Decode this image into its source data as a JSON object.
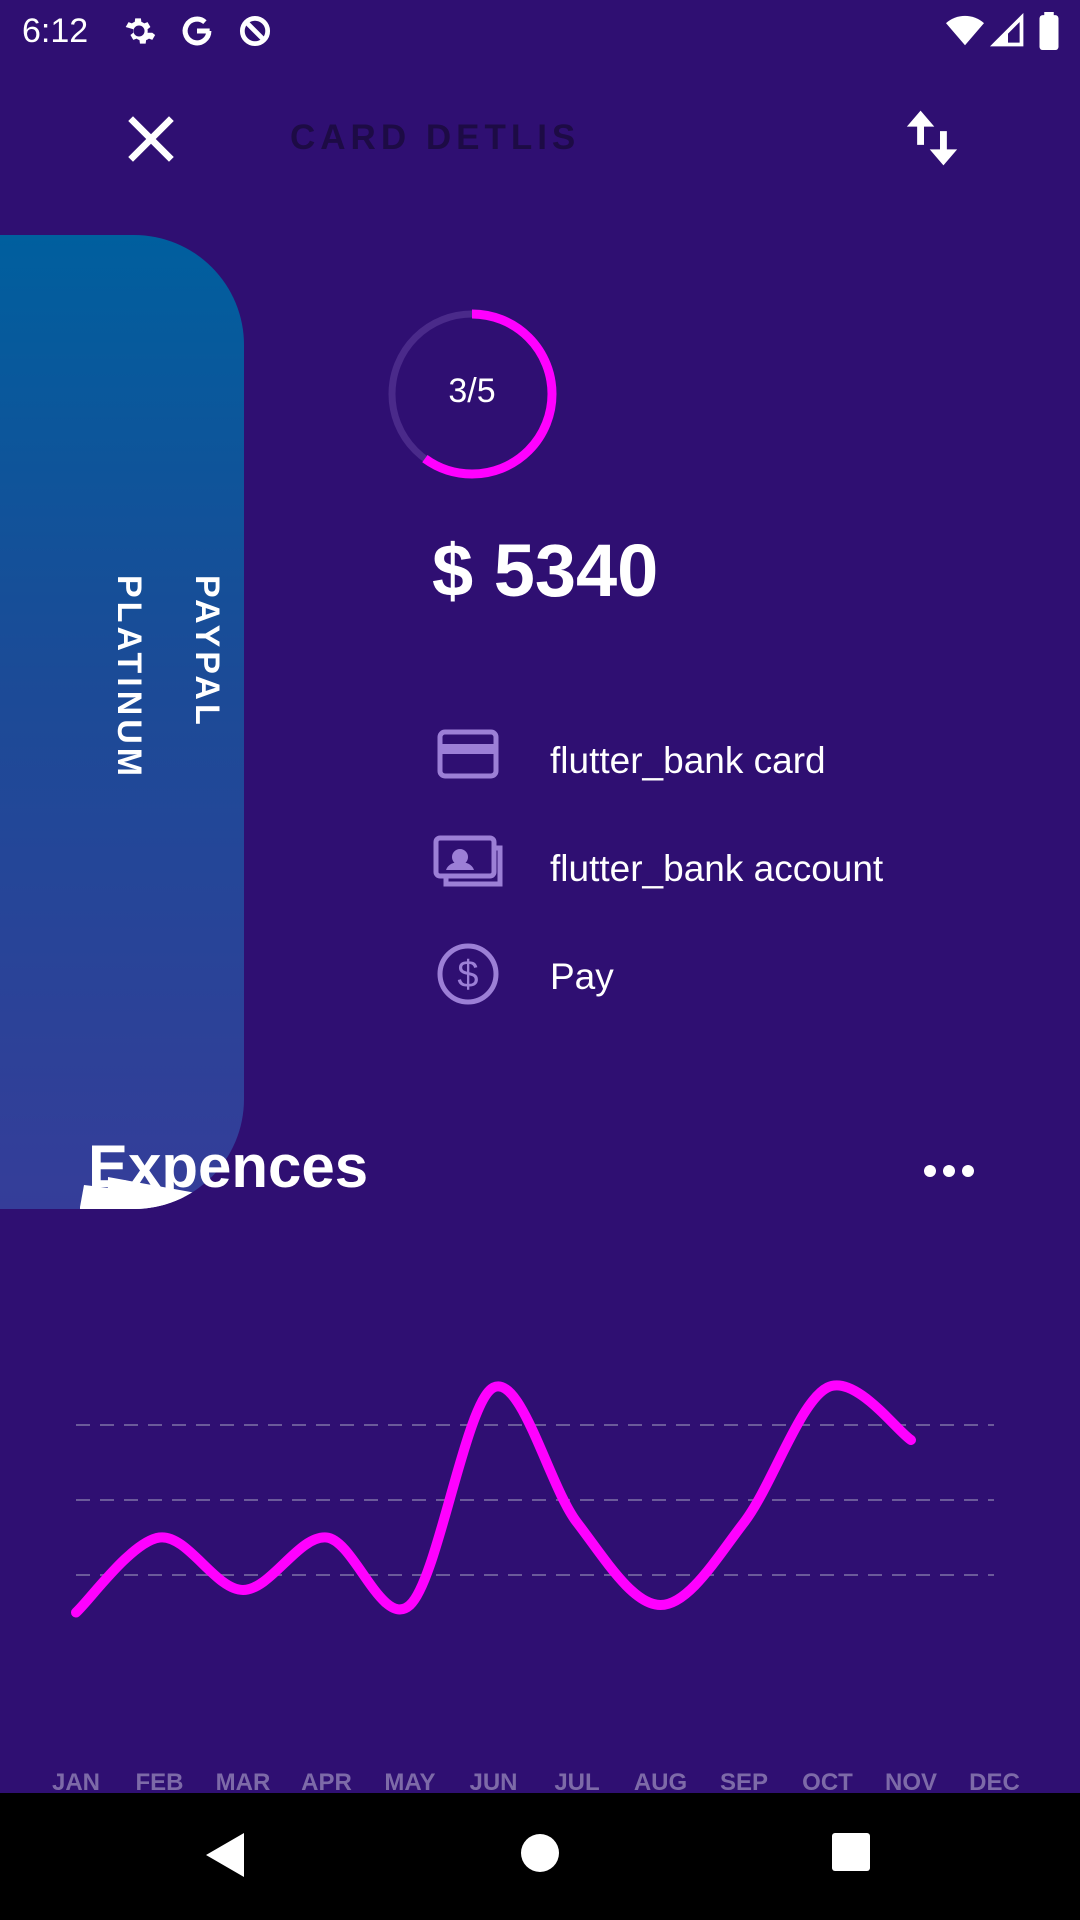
{
  "status_bar": {
    "time": "6:12"
  },
  "app_bar": {
    "title": "CARD DETLIS"
  },
  "card": {
    "name": "PAYPAL\nPLATINUM"
  },
  "summary": {
    "progress_label": "3/5",
    "progress_fraction": 0.6,
    "balance": "$ 5340"
  },
  "options": [
    {
      "label": "flutter_bank card",
      "icon": "credit-card-icon"
    },
    {
      "label": "flutter_bank account",
      "icon": "money-icon"
    },
    {
      "label": "Pay",
      "icon": "dollar-circle-icon"
    }
  ],
  "expenses": {
    "title": "Expences"
  },
  "colors": {
    "background": "#2f0f72",
    "accent": "#ff00ff"
  },
  "chart_data": {
    "type": "line",
    "categories": [
      "JAN",
      "FEB",
      "MAR",
      "APR",
      "MAY",
      "JUN",
      "JUL",
      "AUG",
      "SEP",
      "OCT",
      "NOV",
      "DEC"
    ],
    "values": [
      0.5,
      1.5,
      0.8,
      1.5,
      0.6,
      3.5,
      1.7,
      0.6,
      1.7,
      3.5,
      2.8
    ],
    "ylim": [
      0,
      4
    ],
    "grid_lines": [
      1,
      2,
      3
    ],
    "grid": true
  }
}
